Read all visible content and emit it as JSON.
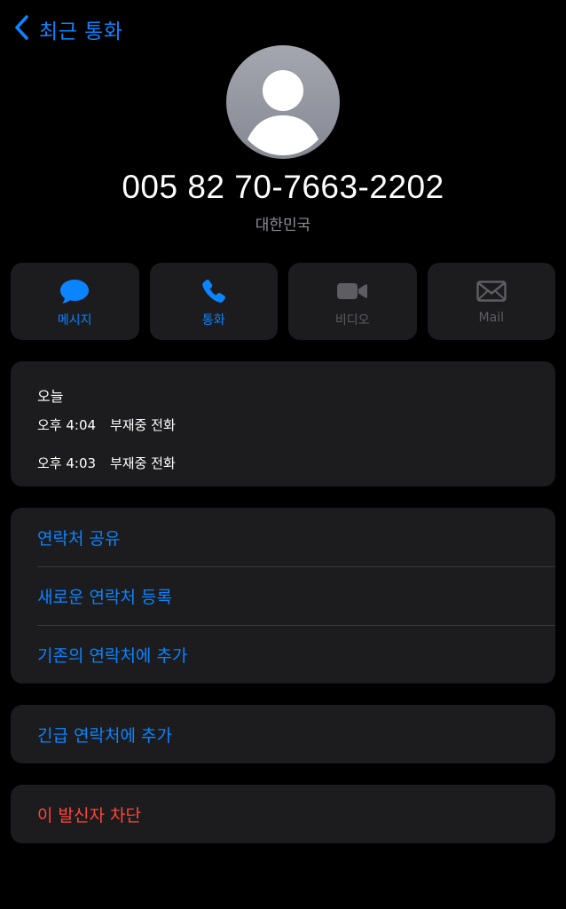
{
  "nav": {
    "back_label": "최근 통화"
  },
  "contact": {
    "phone_number": "005 82 70-7663-2202",
    "country": "대한민국"
  },
  "actions": [
    {
      "label": "메시지",
      "icon": "message-bubble-icon",
      "enabled": true
    },
    {
      "label": "통화",
      "icon": "phone-icon",
      "enabled": true
    },
    {
      "label": "비디오",
      "icon": "video-camera-icon",
      "enabled": false
    },
    {
      "label": "Mail",
      "icon": "envelope-icon",
      "enabled": false
    }
  ],
  "recent_calls": {
    "day": "오늘",
    "items": [
      {
        "time": "오후 4:04",
        "type": "부재중 전화"
      },
      {
        "time": "오후 4:03",
        "type": "부재중 전화"
      }
    ]
  },
  "contact_options": {
    "share": "연락처 공유",
    "create_new": "새로운 연락처 등록",
    "add_existing": "기존의 연락처에 추가"
  },
  "emergency": {
    "add": "긴급 연락처에 추가"
  },
  "block": {
    "label": "이 발신자 차단"
  },
  "colors": {
    "accent": "#0a84ff",
    "destructive": "#ff453a",
    "card_bg": "#1c1c1e",
    "disabled": "#5d5d62",
    "secondary_text": "#8e8e93"
  }
}
